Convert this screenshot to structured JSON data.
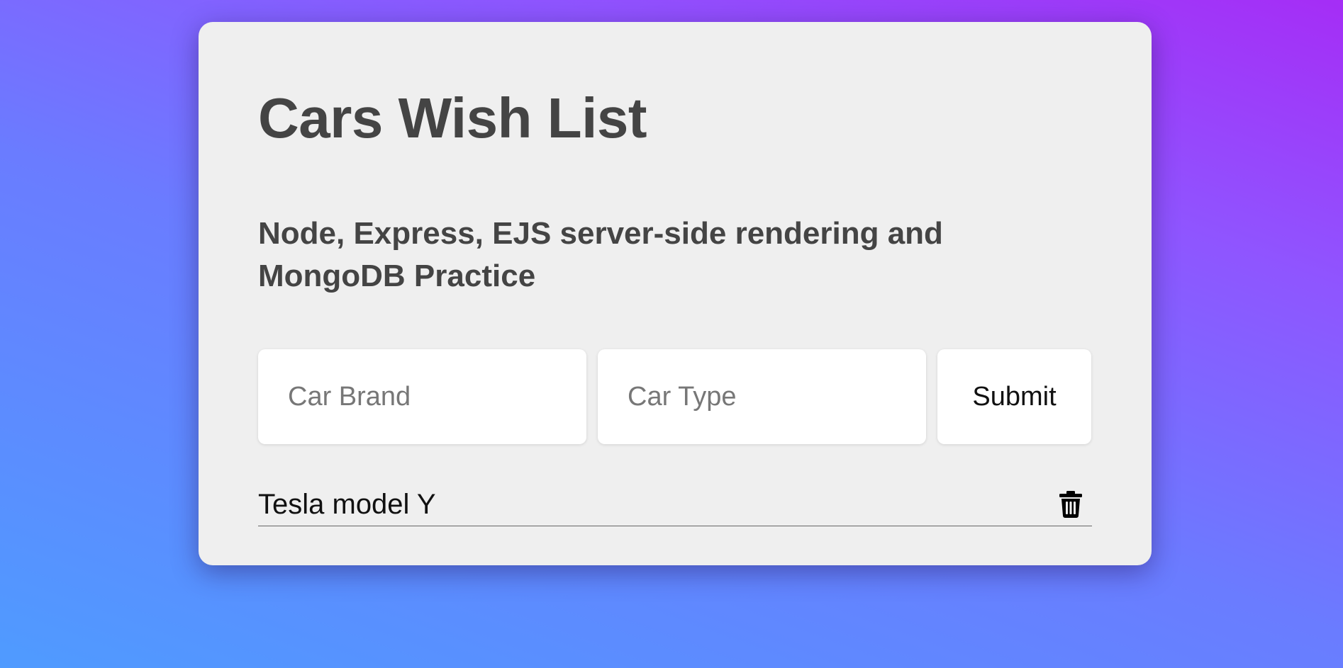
{
  "header": {
    "title": "Cars Wish List",
    "subtitle": "Node, Express, EJS server-side rendering and MongoDB Practice"
  },
  "form": {
    "brand_placeholder": "Car Brand",
    "type_placeholder": "Car Type",
    "submit_label": "Submit"
  },
  "list": {
    "items": [
      {
        "label": "Tesla model Y",
        "icon": "trash-icon"
      }
    ]
  },
  "colors": {
    "card_background": "#efefef",
    "heading_text": "#444444",
    "gradient_start": "#4f9bff",
    "gradient_end": "#a52df6"
  }
}
